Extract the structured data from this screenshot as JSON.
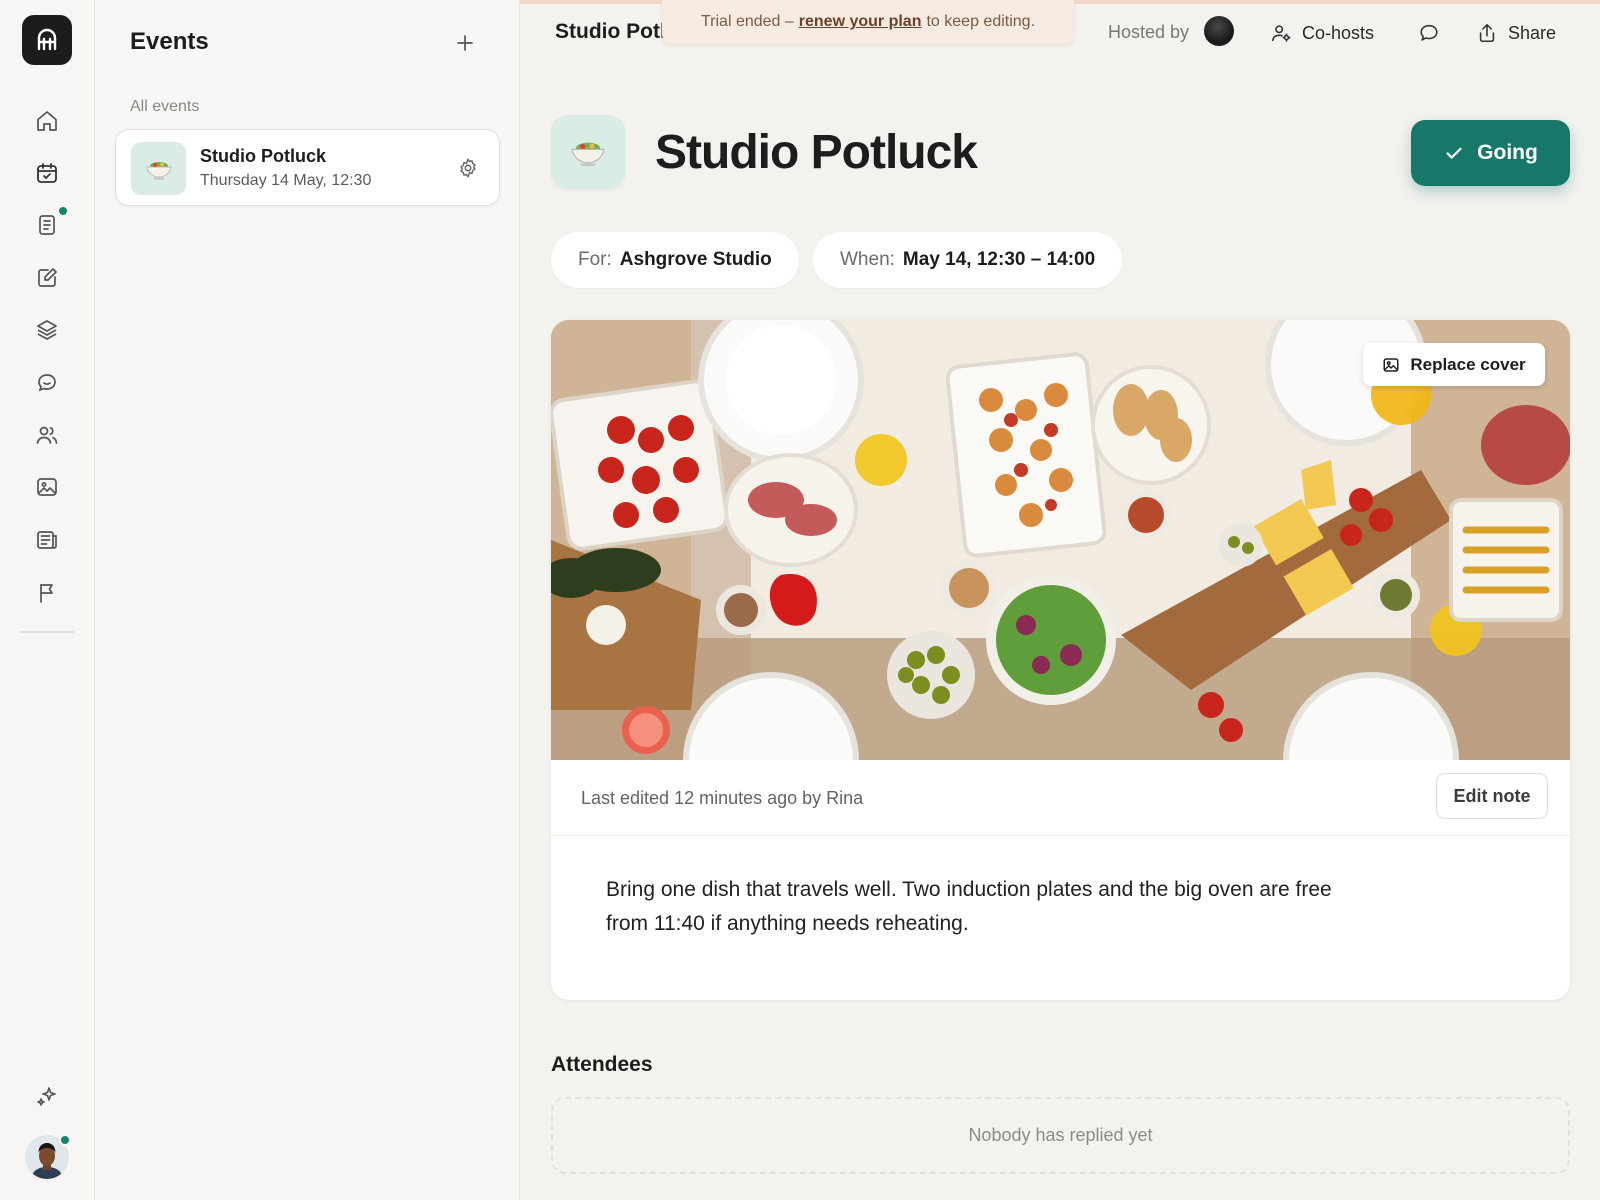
{
  "colors": {
    "accent": "#17786a",
    "notification_dot": "#17856d",
    "trial_banner_bg": "#f6ebe2",
    "page_bg": "#f4f2ef"
  },
  "rail": {
    "logo_icon": "logo-icon",
    "items": [
      {
        "name": "home",
        "icon": "home-icon"
      },
      {
        "name": "calendar",
        "icon": "calendar-icon"
      },
      {
        "name": "notes",
        "icon": "notes-icon",
        "has_dot": true
      },
      {
        "name": "compose",
        "icon": "edit-icon"
      },
      {
        "name": "layers",
        "icon": "layers-icon"
      },
      {
        "name": "chat",
        "icon": "chat-icon"
      },
      {
        "name": "people",
        "icon": "people-icon"
      },
      {
        "name": "photos",
        "icon": "image-icon"
      },
      {
        "name": "news",
        "icon": "newspaper-icon"
      },
      {
        "name": "flag",
        "icon": "flag-icon"
      }
    ],
    "bottom": {
      "ai_icon": "sparkle-icon",
      "avatar_icon": "avatar-icon"
    }
  },
  "events_panel": {
    "title": "Events",
    "section_label": "All events",
    "items": [
      {
        "name": "Studio Potluck",
        "date": "Thursday 14 May, 12:30"
      }
    ]
  },
  "header": {
    "title": "Studio Potl",
    "trial": {
      "prefix": "Trial ended –",
      "link": "renew your plan",
      "suffix": "to keep editing."
    },
    "hosted_by": "Hosted by",
    "cohosts": "Co-hosts",
    "share": "Share"
  },
  "event": {
    "title": "Studio Potluck",
    "rsvp": "Going",
    "for_label": "For:",
    "for_value": "Ashgrove Studio",
    "when_label": "When:",
    "when_value": "May 14, 12:30 – 14:00",
    "replace_cover": "Replace cover",
    "last_edited": "Last edited 12 minutes ago by Rina",
    "edit_note": "Edit note",
    "note": "Bring one dish that travels well. Two induction plates and the big oven are free from 11:40 if anything needs reheating."
  },
  "attendees": {
    "title": "Attendees",
    "empty": "Nobody has replied yet"
  }
}
